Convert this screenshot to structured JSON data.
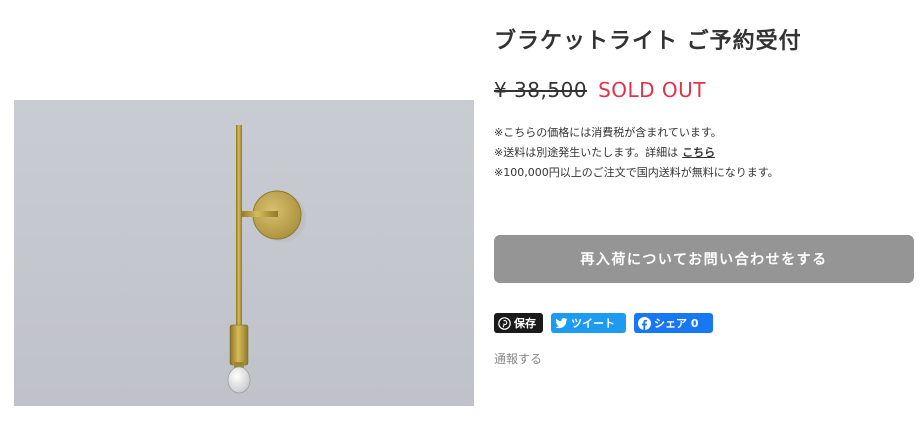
{
  "product": {
    "title": "ブラケットライト ご予約受付",
    "price": "¥ 38,500",
    "status": "SOLD OUT"
  },
  "notes": {
    "tax": "※こちらの価格には消費税が含まれています。",
    "shipping": "※送料は別途発生いたします。詳細は",
    "shipping_link": "こちら",
    "free_shipping": "※100,000円以上のご注文で国内送料が無料になります。"
  },
  "restock_button": {
    "label": "再入荷についてお問い合わせをする"
  },
  "share": {
    "pinterest_label": "保存",
    "tweet_label": "ツイート",
    "facebook_label": "シェア 0"
  },
  "report_link": "通報する",
  "colors": {
    "sold_out": "#e0324b",
    "button_bg": "#959595",
    "tweet": "#1d9bf0",
    "facebook": "#1877f2",
    "pinterest": "#1a1a1a"
  },
  "icons": [
    "pinterest-icon",
    "twitter-icon",
    "facebook-icon"
  ]
}
